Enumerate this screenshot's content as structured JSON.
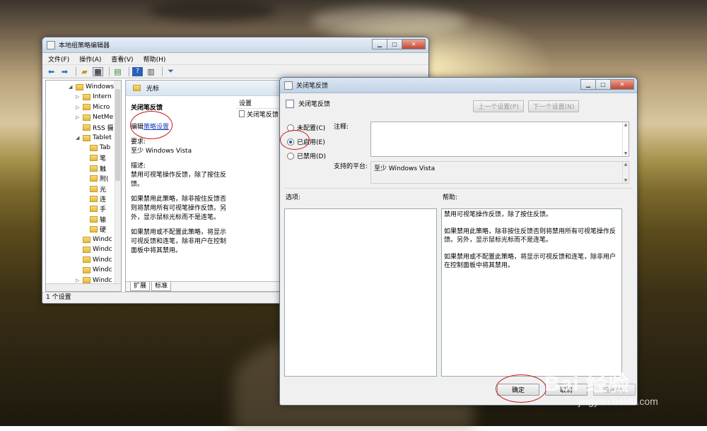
{
  "watermark": {
    "brand": "Bai 经验",
    "url": "jingyan.baidu.com"
  },
  "main_window": {
    "title": "本地组策略编辑器",
    "menu": [
      "文件(F)",
      "操作(A)",
      "查看(V)",
      "帮助(H)"
    ],
    "toolbar_icons": [
      "back-arrow-icon",
      "forward-arrow-icon",
      "up-folder-icon",
      "show-tree-icon",
      "export-icon",
      "help-icon",
      "properties-icon",
      "filter-icon"
    ],
    "tree": [
      {
        "label": "Windows",
        "indent": 2,
        "arrow": "open"
      },
      {
        "label": "Intern",
        "indent": 3,
        "arrow": "closed"
      },
      {
        "label": "Micro",
        "indent": 3,
        "arrow": "closed"
      },
      {
        "label": "NetMe",
        "indent": 3,
        "arrow": "closed"
      },
      {
        "label": "RSS 摄",
        "indent": 3,
        "arrow": "none"
      },
      {
        "label": "Tablet",
        "indent": 3,
        "arrow": "open"
      },
      {
        "label": "Tab",
        "indent": 4,
        "arrow": "none"
      },
      {
        "label": "笔",
        "indent": 4,
        "arrow": "none"
      },
      {
        "label": "触",
        "indent": 4,
        "arrow": "none"
      },
      {
        "label": "附(",
        "indent": 4,
        "arrow": "none"
      },
      {
        "label": "光",
        "indent": 4,
        "arrow": "none"
      },
      {
        "label": "连",
        "indent": 4,
        "arrow": "none"
      },
      {
        "label": "手",
        "indent": 4,
        "arrow": "none"
      },
      {
        "label": "输",
        "indent": 4,
        "arrow": "none"
      },
      {
        "label": "硬",
        "indent": 4,
        "arrow": "none"
      },
      {
        "label": "Windc",
        "indent": 3,
        "arrow": "none"
      },
      {
        "label": "Windc",
        "indent": 3,
        "arrow": "none"
      },
      {
        "label": "Windc",
        "indent": 3,
        "arrow": "none"
      },
      {
        "label": "Windc",
        "indent": 3,
        "arrow": "none"
      },
      {
        "label": "Windc",
        "indent": 3,
        "arrow": "closed"
      }
    ],
    "pane_header": "光标",
    "desc": {
      "title": "关闭笔反馈",
      "edit_prefix": "编辑",
      "edit_link": "策略设置",
      "req_label": "要求:",
      "req_value": "至少 Windows Vista",
      "desc_label": "描述:",
      "desc_1": "禁用可视笔操作反馈，除了按住反馈。",
      "desc_2": "如果禁用此策略，除非按住反馈否则将禁用所有可视笔操作反馈。另外，显示鼠标光标而不是连笔。",
      "desc_3": "如果禁用或不配置此策略，将显示可视反馈和连笔，除非用户在控制面板中将其禁用。"
    },
    "settings_header": "设置",
    "settings_row": "关闭笔反馈",
    "tabs": [
      "扩展",
      "标准"
    ],
    "status": "1 个设置"
  },
  "dialog": {
    "title": "关闭笔反馈",
    "header": "关闭笔反馈",
    "prev_label": "上一个设置(P)",
    "next_label": "下一个设置(N)",
    "radios": [
      "未配置(C)",
      "已启用(E)",
      "已禁用(D)"
    ],
    "selected_radio": "已启用(E)",
    "comment_label": "注释:",
    "platform_label": "支持的平台:",
    "platform_value": "至少 Windows Vista",
    "options_label": "选项:",
    "help_label": "帮助:",
    "help_1": "禁用可视笔操作反馈，除了按住反馈。",
    "help_2": "如果禁用此策略，除非按住反馈否则将禁用所有可视笔操作反馈。另外，显示鼠标光标而不是连笔。",
    "help_3": "如果禁用或不配置此策略，将显示可视反馈和连笔，除非用户在控制面板中将其禁用。",
    "ok_label": "确定",
    "cancel_label": "取消",
    "apply_label": "应用(A)"
  },
  "colors": {
    "annotation_ring": "#c41a1a",
    "link": "#1a3fb5"
  }
}
